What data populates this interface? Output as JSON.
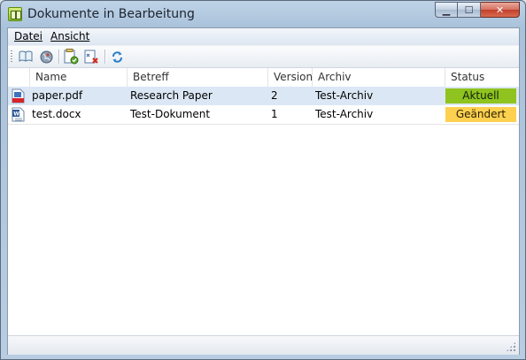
{
  "window": {
    "title": "Dokumente in Bearbeitung",
    "controls": {
      "minimize": "▁",
      "maximize": "☐",
      "close": "✕"
    }
  },
  "menu": [
    {
      "label": "Datei"
    },
    {
      "label": "Ansicht"
    }
  ],
  "toolbar": {
    "icons": [
      "open-book-icon",
      "globe-icon",
      "checkin-document-icon",
      "discard-document-icon",
      "refresh-icon"
    ]
  },
  "table": {
    "columns": [
      "Name",
      "Betreff",
      "Version",
      "Archiv",
      "Status"
    ],
    "rows": [
      {
        "name": "paper.pdf",
        "subject": "Research Paper",
        "version": "2",
        "archive": "Test-Archiv",
        "status": "Aktuell",
        "status_color": "#8fc31f",
        "file_icon": "pdf-file-icon",
        "selected": true
      },
      {
        "name": "test.docx",
        "subject": "Test-Dokument",
        "version": "1",
        "archive": "Test-Archiv",
        "status": "Geändert",
        "status_color": "#fdd050",
        "file_icon": "word-file-icon",
        "selected": false
      }
    ]
  },
  "colors": {
    "selection": "#dbe7f4",
    "status_current": "#8fc31f",
    "status_changed": "#fdd050"
  }
}
